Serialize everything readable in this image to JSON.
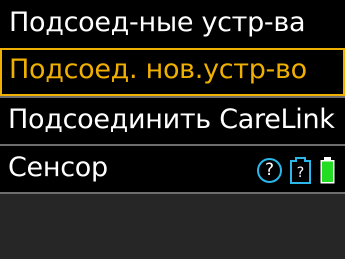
{
  "header": {
    "title": "Подсоед-ные устр-ва"
  },
  "menu": {
    "items": [
      {
        "label": "Подсоед. нов.устр-во",
        "selected": true
      },
      {
        "label": "Подсоединить CareLink",
        "selected": false
      },
      {
        "label": "Сенсор",
        "selected": false
      }
    ]
  },
  "status": {
    "help_glyph": "?",
    "sensor_glyph": "?",
    "battery_level": 1.0
  },
  "colors": {
    "accent": "#f0b000",
    "icon_blue": "#2bb7e8",
    "battery_green": "#22dd22"
  },
  "icons": {
    "help": "question-circle-icon",
    "sensor": "sensor-unknown-icon",
    "battery": "battery-full-icon"
  }
}
